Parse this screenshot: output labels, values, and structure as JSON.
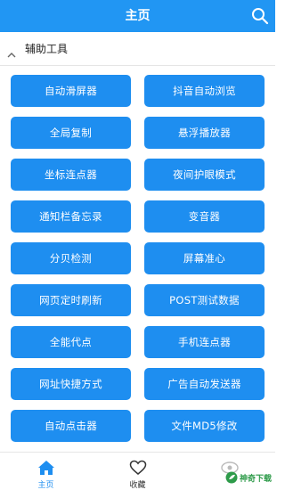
{
  "header": {
    "title": "主页",
    "search_icon": "search-icon"
  },
  "section": {
    "label": "辅助工具",
    "icon": "chevron-up-icon"
  },
  "tools": [
    {
      "label": "自动滑屏器"
    },
    {
      "label": "抖音自动浏览"
    },
    {
      "label": "全局复制"
    },
    {
      "label": "悬浮播放器"
    },
    {
      "label": "坐标连点器"
    },
    {
      "label": "夜间护眼模式"
    },
    {
      "label": "通知栏备忘录"
    },
    {
      "label": "变音器"
    },
    {
      "label": "分贝检测"
    },
    {
      "label": "屏幕准心"
    },
    {
      "label": "网页定时刷新"
    },
    {
      "label": "POST测试数据"
    },
    {
      "label": "全能代点"
    },
    {
      "label": "手机连点器"
    },
    {
      "label": "网址快捷方式"
    },
    {
      "label": "广告自动发送器"
    },
    {
      "label": "自动点击器"
    },
    {
      "label": "文件MD5修改"
    }
  ],
  "bottom_nav": {
    "home": {
      "label": "主页",
      "icon": "home-icon"
    },
    "favorites": {
      "label": "收藏",
      "icon": "heart-icon"
    },
    "third": {
      "icon": "eye-icon"
    }
  },
  "watermark": {
    "text": "神奇下载"
  },
  "colors": {
    "primary": "#2196f3",
    "button": "#1e8ef0"
  }
}
